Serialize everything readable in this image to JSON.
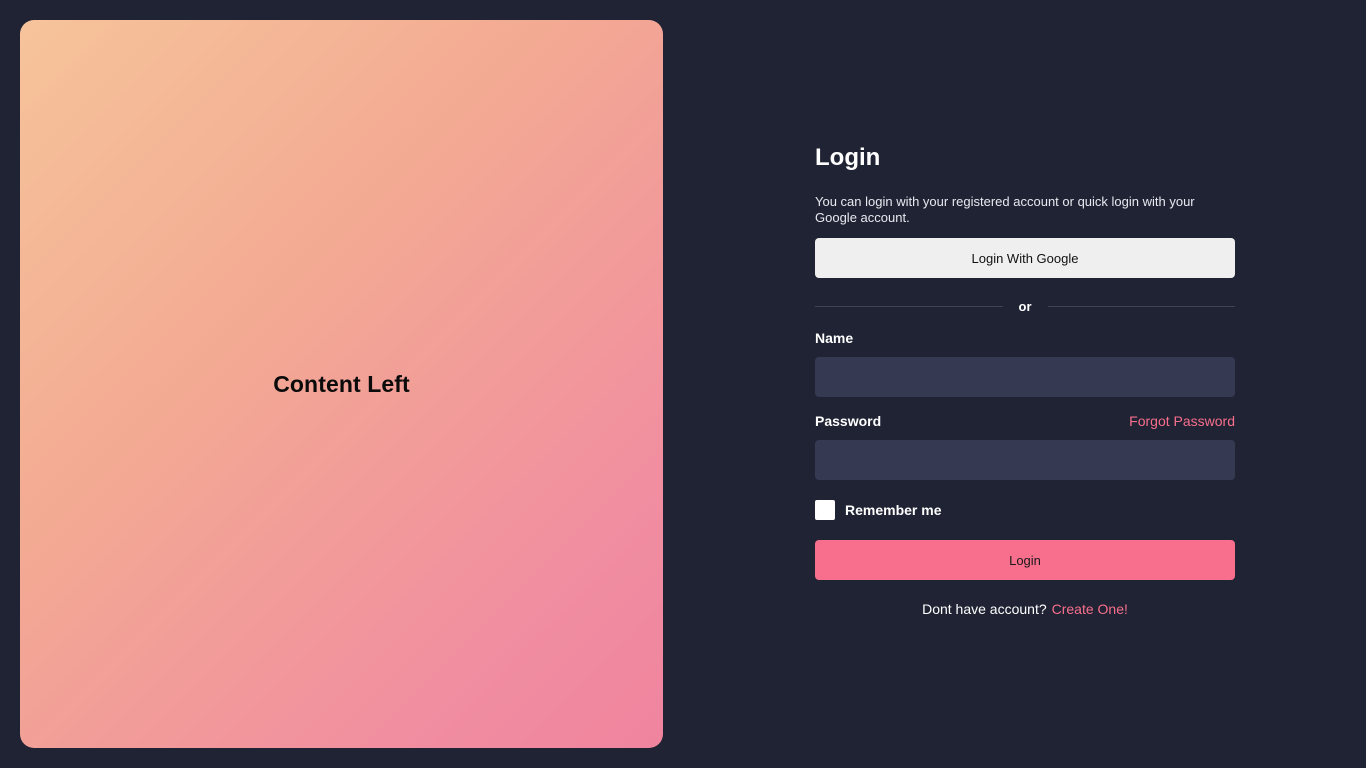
{
  "left_panel": {
    "title": "Content Left"
  },
  "login": {
    "title": "Login",
    "subtitle": "You can login with your registered account or quick login with your Google account.",
    "google_button": "Login With Google",
    "divider_text": "or",
    "name_label": "Name",
    "name_value": "",
    "password_label": "Password",
    "password_value": "",
    "forgot_password": "Forgot Password",
    "remember_me": "Remember me",
    "remember_checked": false,
    "login_button": "Login",
    "signup_prompt": "Dont have account?",
    "signup_link": "Create One!"
  },
  "colors": {
    "background": "#1f2333",
    "accent": "#f86f8d",
    "input_bg": "#353a52",
    "panel_gradient_start": "#f6c49a",
    "panel_gradient_end": "#ef849f"
  }
}
